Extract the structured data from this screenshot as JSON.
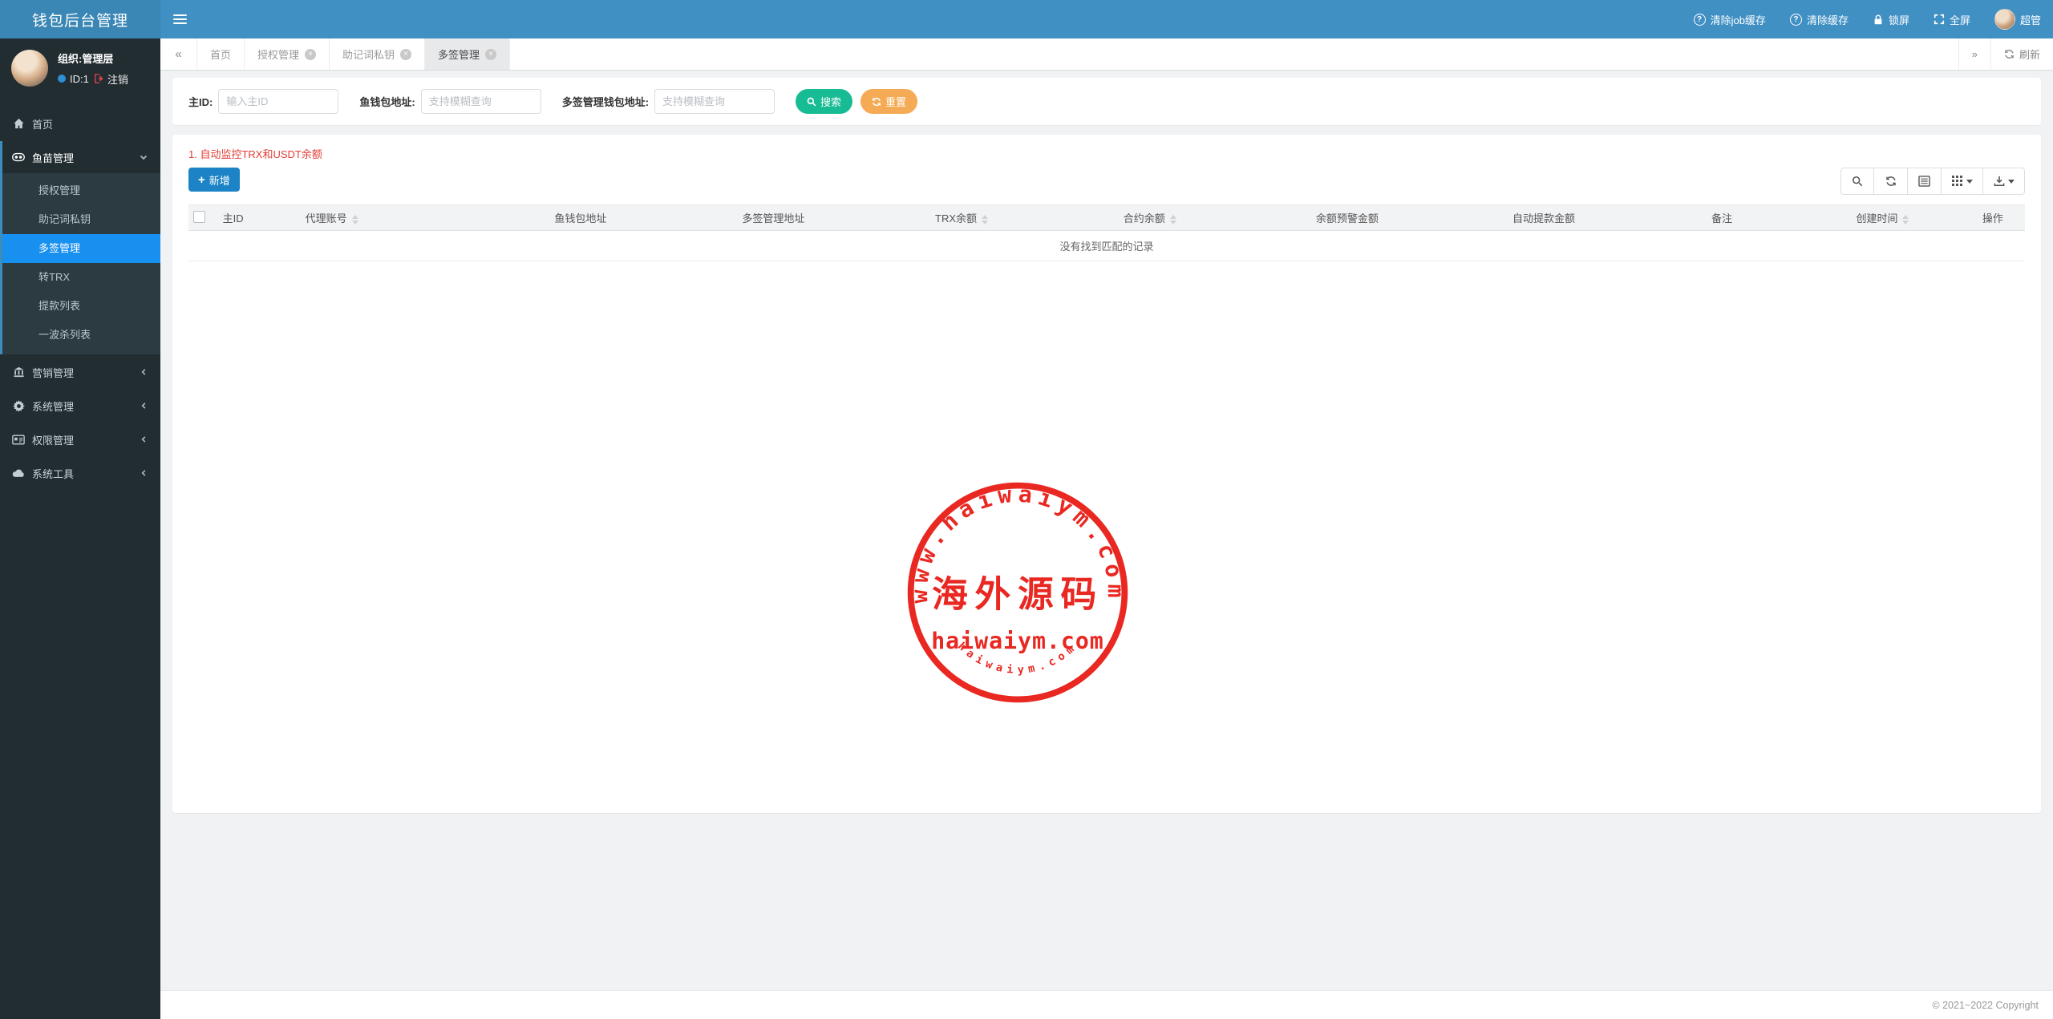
{
  "app": {
    "title": "钱包后台管理"
  },
  "navbar": {
    "actions": [
      {
        "label": "清除job缓存",
        "icon": "question-circle-icon"
      },
      {
        "label": "清除缓存",
        "icon": "question-circle-icon"
      },
      {
        "label": "锁屏",
        "icon": "lock-icon"
      },
      {
        "label": "全屏",
        "icon": "expand-icon"
      },
      {
        "label": "超管",
        "icon": "avatar"
      }
    ]
  },
  "sidebar": {
    "user": {
      "org": "组织:管理层",
      "id_label": "ID:1",
      "logout_label": "注销"
    },
    "menu": [
      {
        "label": "首页",
        "icon": "home-icon"
      },
      {
        "label": "鱼苗管理",
        "icon": "fish-management-icon",
        "expanded": true,
        "children": [
          "授权管理",
          "助记词私钥",
          "多签管理",
          "转TRX",
          "提款列表",
          "一波杀列表"
        ],
        "active_child": "多签管理"
      },
      {
        "label": "营销管理",
        "icon": "bank-icon"
      },
      {
        "label": "系统管理",
        "icon": "gear-icon"
      },
      {
        "label": "权限管理",
        "icon": "idcard-icon"
      },
      {
        "label": "系统工具",
        "icon": "cloud-icon"
      }
    ]
  },
  "tabs": {
    "collapse_left": "«",
    "collapse_right": "»",
    "items": [
      {
        "label": "首页",
        "closable": false,
        "active": false
      },
      {
        "label": "授权管理",
        "closable": true,
        "active": false
      },
      {
        "label": "助记词私钥",
        "closable": true,
        "active": false
      },
      {
        "label": "多签管理",
        "closable": true,
        "active": true
      }
    ],
    "refresh_label": "刷新"
  },
  "search": {
    "fields": [
      {
        "label": "主ID:",
        "placeholder": "输入主ID",
        "value": ""
      },
      {
        "label": "鱼钱包地址:",
        "placeholder": "支持模糊查询",
        "value": ""
      },
      {
        "label": "多签管理钱包地址:",
        "placeholder": "支持模糊查询",
        "value": ""
      }
    ],
    "search_label": "搜索",
    "reset_label": "重置"
  },
  "content": {
    "notice": "1. 自动监控TRX和USDT余额",
    "add_label": "新增",
    "toolbar_icons": [
      "search-icon",
      "refresh-icon",
      "detail-view-icon",
      "columns-icon",
      "export-icon"
    ],
    "table": {
      "columns": [
        {
          "label": "主ID",
          "sortable": false
        },
        {
          "label": "代理账号",
          "sortable": true
        },
        {
          "label": "鱼钱包地址",
          "sortable": false
        },
        {
          "label": "多签管理地址",
          "sortable": false
        },
        {
          "label": "TRX余额",
          "sortable": true
        },
        {
          "label": "合约余额",
          "sortable": true
        },
        {
          "label": "余额预警金额",
          "sortable": false
        },
        {
          "label": "自动提款金额",
          "sortable": false
        },
        {
          "label": "备注",
          "sortable": false
        },
        {
          "label": "创建时间",
          "sortable": true
        },
        {
          "label": "操作",
          "sortable": false
        }
      ],
      "empty": "没有找到匹配的记录",
      "rows": []
    }
  },
  "watermark": {
    "top_text": "www.haiwaiym.com",
    "center_text": "海外源码",
    "middle_text": "haiwaiym.com",
    "bottom_text": "haiwaiym.com",
    "color": "#e9201a"
  },
  "footer": {
    "copyright": "© 2021~2022 Copyright"
  },
  "colors": {
    "navbar": "#4090c4",
    "logo": "#3a86b5",
    "sidebar": "#222d32",
    "submenu": "#2c3b41",
    "active_menu": "#1890f0",
    "search_btn": "#18bc94",
    "reset_btn": "#f5ab55",
    "add_btn": "#1c84c6",
    "notice_red": "#e23c35",
    "page_bg": "#f1f2f4"
  }
}
